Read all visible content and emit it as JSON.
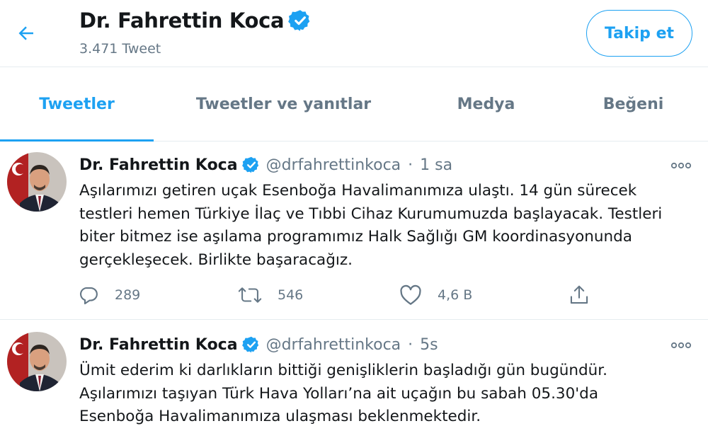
{
  "header": {
    "name": "Dr. Fahrettin Koca",
    "tweet_count": "3.471 Tweet",
    "follow_label": "Takip et"
  },
  "tabs": [
    {
      "label": "Tweetler",
      "active": true
    },
    {
      "label": "Tweetler ve yanıtlar",
      "active": false
    },
    {
      "label": "Medya",
      "active": false
    },
    {
      "label": "Beğeni",
      "active": false
    }
  ],
  "tweets": [
    {
      "author": "Dr. Fahrettin Koca",
      "handle": "@drfahrettinkoca",
      "separator": "·",
      "time": "1 sa",
      "text": "Aşılarımızı getiren uçak Esenboğa Havalimanımıza ulaştı. 14 gün sürecek\ntestleri hemen Türkiye İlaç ve Tıbbi Cihaz Kurumumuzda başlayacak. Testleri\nbiter bitmez ise aşılama programımız Halk Sağlığı GM koordinasyonunda\ngerçekleşecek. Birlikte başaracağız.",
      "replies": "289",
      "retweets": "546",
      "likes": "4,6 B"
    },
    {
      "author": "Dr. Fahrettin Koca",
      "handle": "@drfahrettinkoca",
      "separator": "·",
      "time": "5s",
      "text": "Ümit ederim ki darlıkların bittiği genişliklerin başladığı gün bugündür.\nAşılarımızı taşıyan Türk Hava Yolları’na ait uçağın bu sabah 05.30'da\nEsenboğa Havalimanımıza ulaşması beklenmektedir."
    }
  ],
  "colors": {
    "accent": "#1da1f2",
    "text_primary": "#14171a",
    "text_secondary": "#657786",
    "divider": "#e6ecf0"
  },
  "icons": {
    "back": "arrow-left-icon",
    "verified": "verified-badge-icon",
    "more": "more-dots-icon",
    "reply": "reply-icon",
    "retweet": "retweet-icon",
    "like": "heart-icon",
    "share": "share-icon"
  }
}
